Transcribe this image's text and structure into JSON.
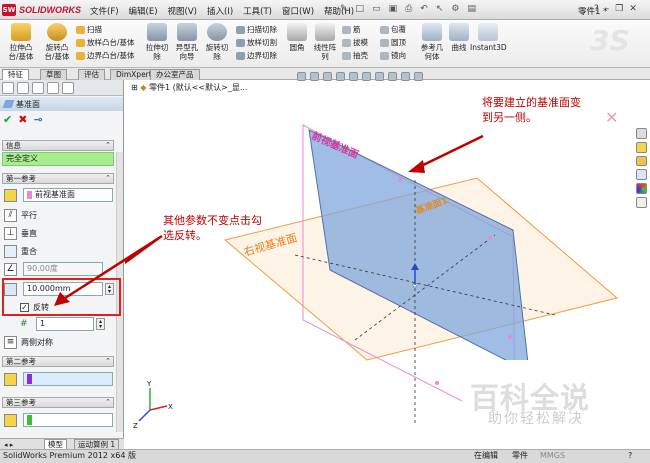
{
  "titlebar": {
    "app": "SOLIDWORKS",
    "menus": [
      "文件(F)",
      "编辑(E)",
      "视图(V)",
      "插入(I)",
      "工具(T)",
      "窗口(W)",
      "帮助(H)"
    ],
    "doc": "零件1 *"
  },
  "ribbon": {
    "extrude_boss": "拉伸凸\n台/基体",
    "revolve_boss": "旋转凸\n台/基体",
    "sweep": "扫描",
    "loft_boss": "放样凸台/基体",
    "boundary_boss": "边界凸台/基体",
    "extrude_cut": "拉伸切\n除",
    "hole_wizard": "异型孔\n向导",
    "revolve_cut": "旋转切\n除",
    "sweep_cut": "扫描切除",
    "loft_cut": "放样切割",
    "boundary_cut": "边界切除",
    "fillet": "圆角",
    "linear_pattern": "线性阵\n列",
    "rib": "筋",
    "draft": "拔模",
    "shell": "抽壳",
    "wrap": "包覆",
    "dome": "圆顶",
    "mirror": "镜向",
    "ref_geometry": "参考几\n何体",
    "curves": "曲线",
    "instant3d": "Instant3D"
  },
  "tabs": [
    "特征",
    "草图",
    "评估",
    "DimXpert",
    "办公室产品"
  ],
  "panel": {
    "title": "基准面",
    "info_header": "信息",
    "message": "完全定义",
    "first_ref_header": "第一参考",
    "first_ref_value": "前视基准面",
    "parallel": "平行",
    "perpendicular": "垂直",
    "coincident": "重合",
    "angle": "90.00度",
    "distance": "10.000mm",
    "flip": "反转",
    "count": "1",
    "symmetric": "两侧对称",
    "second_ref_header": "第二参考",
    "third_ref_header": "第三参考"
  },
  "tree": {
    "item": "零件1 (默认<<默认>_显..."
  },
  "plane_labels": {
    "front": "前视基准面",
    "right": "右视基准面",
    "new": "基准面1"
  },
  "annotations": {
    "top_line1": "将要建立的基准面变",
    "top_line2": "到另一侧。",
    "left_line1": "其他参数不变点击勾",
    "left_line2": "选反转。"
  },
  "bottom_tabs": [
    "模型",
    "运动算例 1"
  ],
  "status": {
    "app": "SolidWorks Premium 2012 x64 版",
    "editing": "在编辑",
    "part": "零件",
    "units": "MMGS"
  },
  "watermark": {
    "main": "百科全说",
    "sub": "助你轻松解决"
  },
  "colors": {
    "plane_blue": "#7fa7dc",
    "plane_orange": "#f39a3a",
    "plane_pink": "#ee88cc",
    "annotation": "#c00000",
    "success": "#a8ee8c"
  }
}
